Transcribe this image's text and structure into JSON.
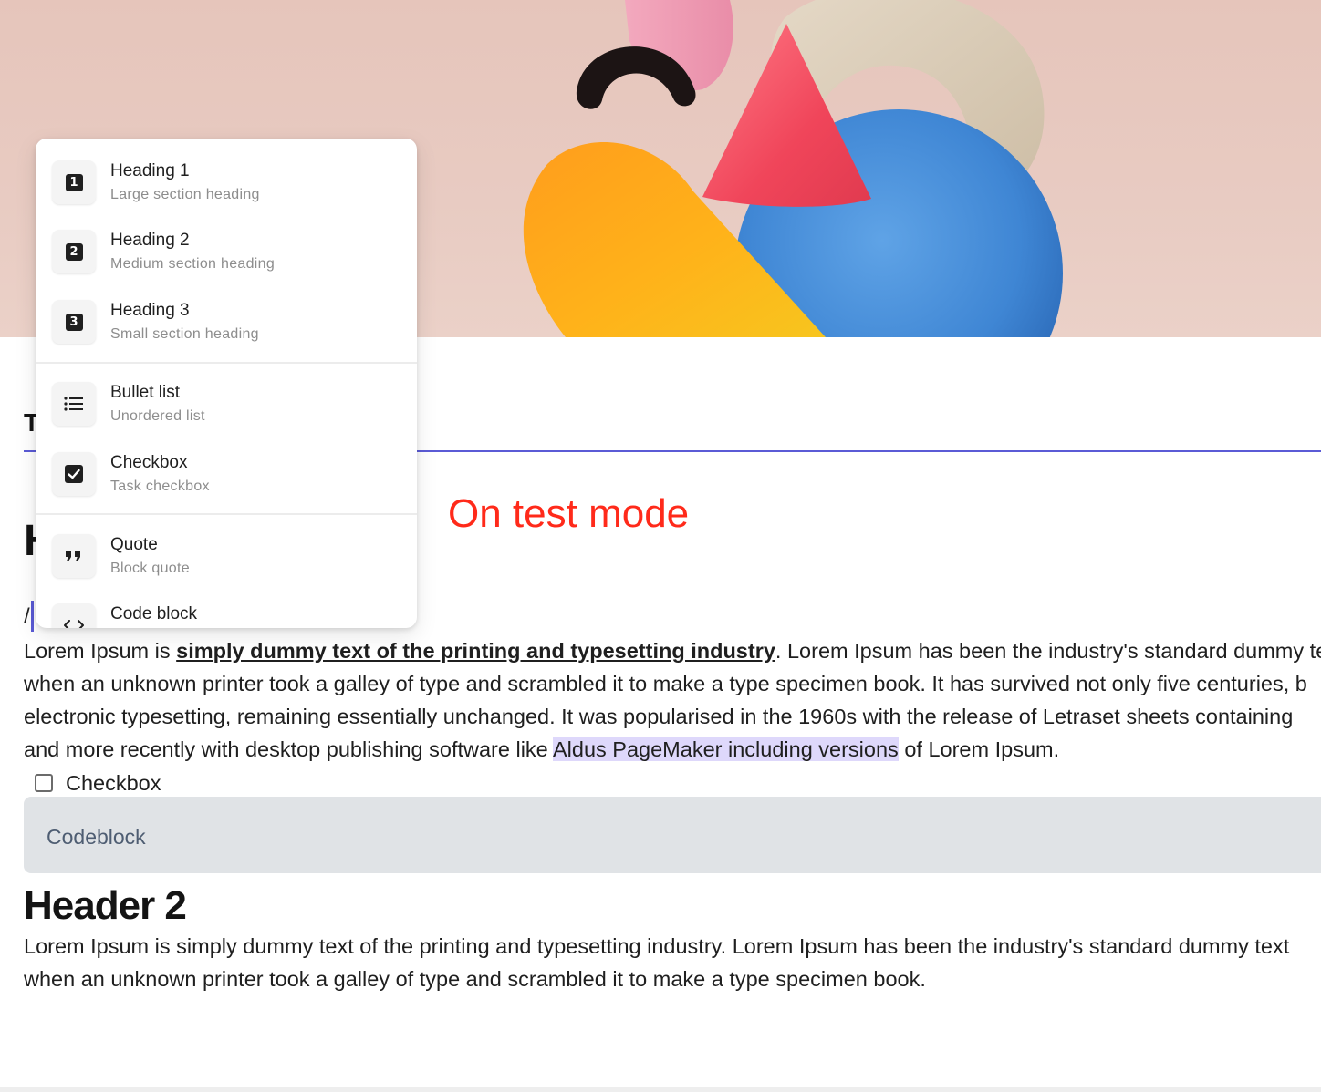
{
  "editor": {
    "title_partial": "T",
    "heading1_partial": "H",
    "slash_text": "/",
    "test_mode_label": "On test mode",
    "paragraph1": {
      "line1_pre": "Lorem Ipsum is ",
      "line1_bold": "simply dummy text of the printing and typesetting industry",
      "line1_post": ". Lorem Ipsum has been the industry's standard dummy text",
      "line2": "when an unknown printer took a galley of type and scrambled it to make a type specimen book. It has survived not only five centuries, b",
      "line3": "electronic typesetting, remaining essentially unchanged. It was popularised in the 1960s with the release of Letraset sheets containing",
      "line4_pre": "and more recently with desktop publishing software like ",
      "line4_highlight": "Aldus PageMaker including versions",
      "line4_post": " of Lorem Ipsum."
    },
    "checkbox_label": "Checkbox",
    "codeblock_text": "Codeblock",
    "heading2": "Header 2",
    "paragraph2": {
      "line1": "Lorem Ipsum is simply dummy text of the printing and typesetting industry. Lorem Ipsum has been the industry's standard dummy text",
      "line2": "when an unknown printer took a galley of type and scrambled it to make a type specimen book."
    }
  },
  "slash_menu": {
    "items": [
      {
        "title": "Heading 1",
        "subtitle": "Large section heading",
        "icon": "heading-1-icon"
      },
      {
        "title": "Heading 2",
        "subtitle": "Medium section heading",
        "icon": "heading-2-icon"
      },
      {
        "title": "Heading 3",
        "subtitle": "Small section heading",
        "icon": "heading-3-icon"
      },
      {
        "title": "Bullet list",
        "subtitle": "Unordered list",
        "icon": "bullet-list-icon"
      },
      {
        "title": "Checkbox",
        "subtitle": "Task checkbox",
        "icon": "checkbox-icon"
      },
      {
        "title": "Quote",
        "subtitle": "Block quote",
        "icon": "quote-icon"
      },
      {
        "title": "Code block",
        "subtitle": "",
        "icon": "code-icon"
      }
    ],
    "icon_digits": [
      "1",
      "2",
      "3"
    ]
  },
  "colors": {
    "accent": "#5b5bd6",
    "test_mode": "#ff2a1a",
    "highlight": "#ded8fb",
    "codeblock_bg": "#e0e3e6"
  }
}
